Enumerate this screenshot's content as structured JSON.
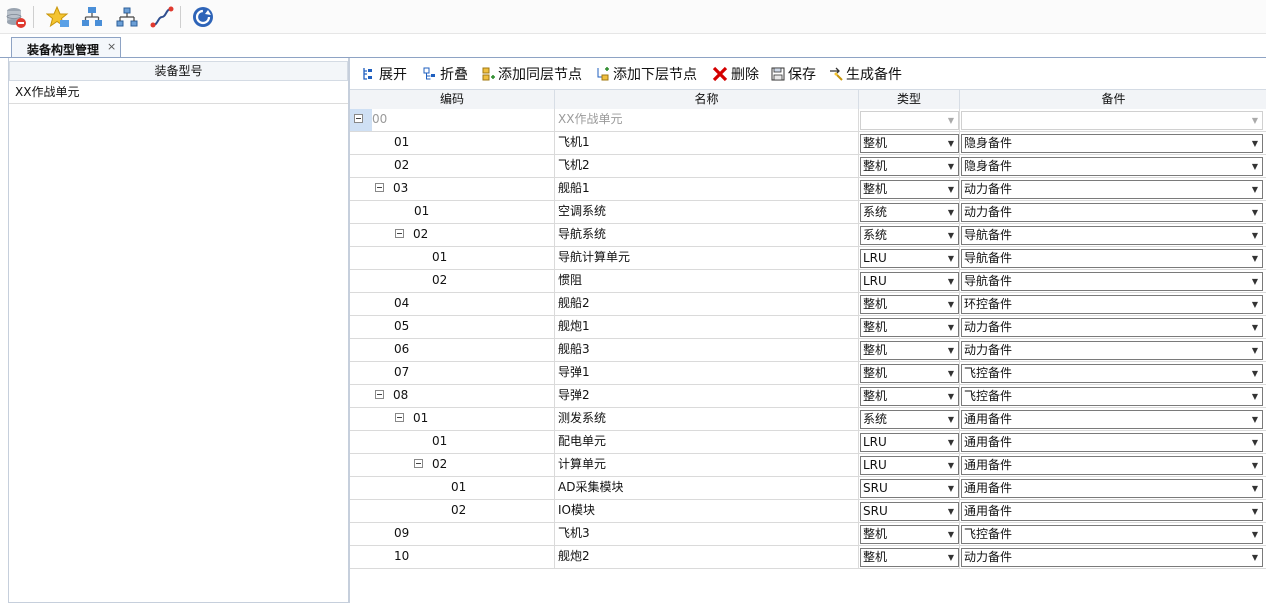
{
  "toolbar": {
    "icons": [
      "database-remove-icon",
      "favorite-star-icon",
      "org-structure-icon",
      "hierarchy-icon",
      "path-icon",
      "refresh-icon"
    ]
  },
  "tab": {
    "label": "装备构型管理",
    "close": "×"
  },
  "left": {
    "header": "装备型号",
    "items": [
      "XX作战单元"
    ]
  },
  "ops": {
    "expand": "展开",
    "collapse": "折叠",
    "add_sibling": "添加同层节点",
    "add_child": "添加下层节点",
    "delete": "删除",
    "save": "保存",
    "generate": "生成备件"
  },
  "grid": {
    "headers": {
      "code": "编码",
      "name": "名称",
      "type": "类型",
      "part": "备件"
    },
    "rows": [
      {
        "code": "00",
        "name": "XX作战单元",
        "type": "",
        "part": "",
        "level": 0,
        "toggle": "⊟",
        "disabled": true
      },
      {
        "code": "01",
        "name": "飞机1",
        "type": "整机",
        "part": "隐身备件",
        "level": 1,
        "toggle": ""
      },
      {
        "code": "02",
        "name": "飞机2",
        "type": "整机",
        "part": "隐身备件",
        "level": 1,
        "toggle": ""
      },
      {
        "code": "03",
        "name": "舰船1",
        "type": "整机",
        "part": "动力备件",
        "level": 1,
        "toggle": "⊟"
      },
      {
        "code": "01",
        "name": "空调系统",
        "type": "系统",
        "part": "动力备件",
        "level": 2,
        "toggle": ""
      },
      {
        "code": "02",
        "name": "导航系统",
        "type": "系统",
        "part": "导航备件",
        "level": 2,
        "toggle": "⊟"
      },
      {
        "code": "01",
        "name": "导航计算单元",
        "type": "LRU",
        "part": "导航备件",
        "level": 3,
        "toggle": ""
      },
      {
        "code": "02",
        "name": "惯阻",
        "type": "LRU",
        "part": "导航备件",
        "level": 3,
        "toggle": ""
      },
      {
        "code": "04",
        "name": "舰船2",
        "type": "整机",
        "part": "环控备件",
        "level": 1,
        "toggle": ""
      },
      {
        "code": "05",
        "name": "舰炮1",
        "type": "整机",
        "part": "动力备件",
        "level": 1,
        "toggle": ""
      },
      {
        "code": "06",
        "name": "舰船3",
        "type": "整机",
        "part": "动力备件",
        "level": 1,
        "toggle": ""
      },
      {
        "code": "07",
        "name": "导弹1",
        "type": "整机",
        "part": "飞控备件",
        "level": 1,
        "toggle": ""
      },
      {
        "code": "08",
        "name": "导弹2",
        "type": "整机",
        "part": "飞控备件",
        "level": 1,
        "toggle": "⊟"
      },
      {
        "code": "01",
        "name": "测发系统",
        "type": "系统",
        "part": "通用备件",
        "level": 2,
        "toggle": "⊟"
      },
      {
        "code": "01",
        "name": "配电单元",
        "type": "LRU",
        "part": "通用备件",
        "level": 3,
        "toggle": ""
      },
      {
        "code": "02",
        "name": "计算单元",
        "type": "LRU",
        "part": "通用备件",
        "level": 3,
        "toggle": "⊟"
      },
      {
        "code": "01",
        "name": "AD采集模块",
        "type": "SRU",
        "part": "通用备件",
        "level": 4,
        "toggle": ""
      },
      {
        "code": "02",
        "name": "IO模块",
        "type": "SRU",
        "part": "通用备件",
        "level": 4,
        "toggle": ""
      },
      {
        "code": "09",
        "name": "飞机3",
        "type": "整机",
        "part": "飞控备件",
        "level": 1,
        "toggle": ""
      },
      {
        "code": "10",
        "name": "舰炮2",
        "type": "整机",
        "part": "动力备件",
        "level": 1,
        "toggle": ""
      }
    ]
  },
  "colors": {
    "accent": "#1f5fbf",
    "delete": "#d40000",
    "selection": "#cfe0f4"
  }
}
